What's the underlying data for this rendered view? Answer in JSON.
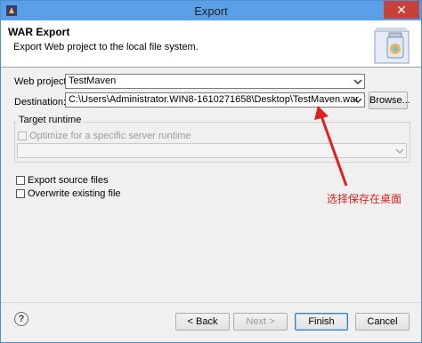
{
  "window": {
    "title": "Export",
    "close_glyph": "✕"
  },
  "banner": {
    "heading": "WAR Export",
    "description": "Export Web project to the local file system.",
    "icon": "war-jar-icon"
  },
  "form": {
    "web_project": {
      "label": "Web project:",
      "value": "TestMaven"
    },
    "destination": {
      "label": "Destination:",
      "value": "C:\\Users\\Administrator.WIN8-1610271658\\Desktop\\TestMaven.war",
      "browse_label": "Browse..."
    },
    "target_runtime": {
      "group_label": "Target runtime",
      "optimize_label": "Optimize for a specific server runtime",
      "runtime_value": ""
    },
    "export_source": {
      "label": "Export source files",
      "checked": false
    },
    "overwrite": {
      "label": "Overwrite existing file",
      "checked": false
    }
  },
  "annotation": {
    "text": "选择保存在桌面",
    "color": "#e0201c"
  },
  "buttons": {
    "back": "< Back",
    "next": "Next >",
    "finish": "Finish",
    "cancel": "Cancel",
    "help_glyph": "?"
  }
}
